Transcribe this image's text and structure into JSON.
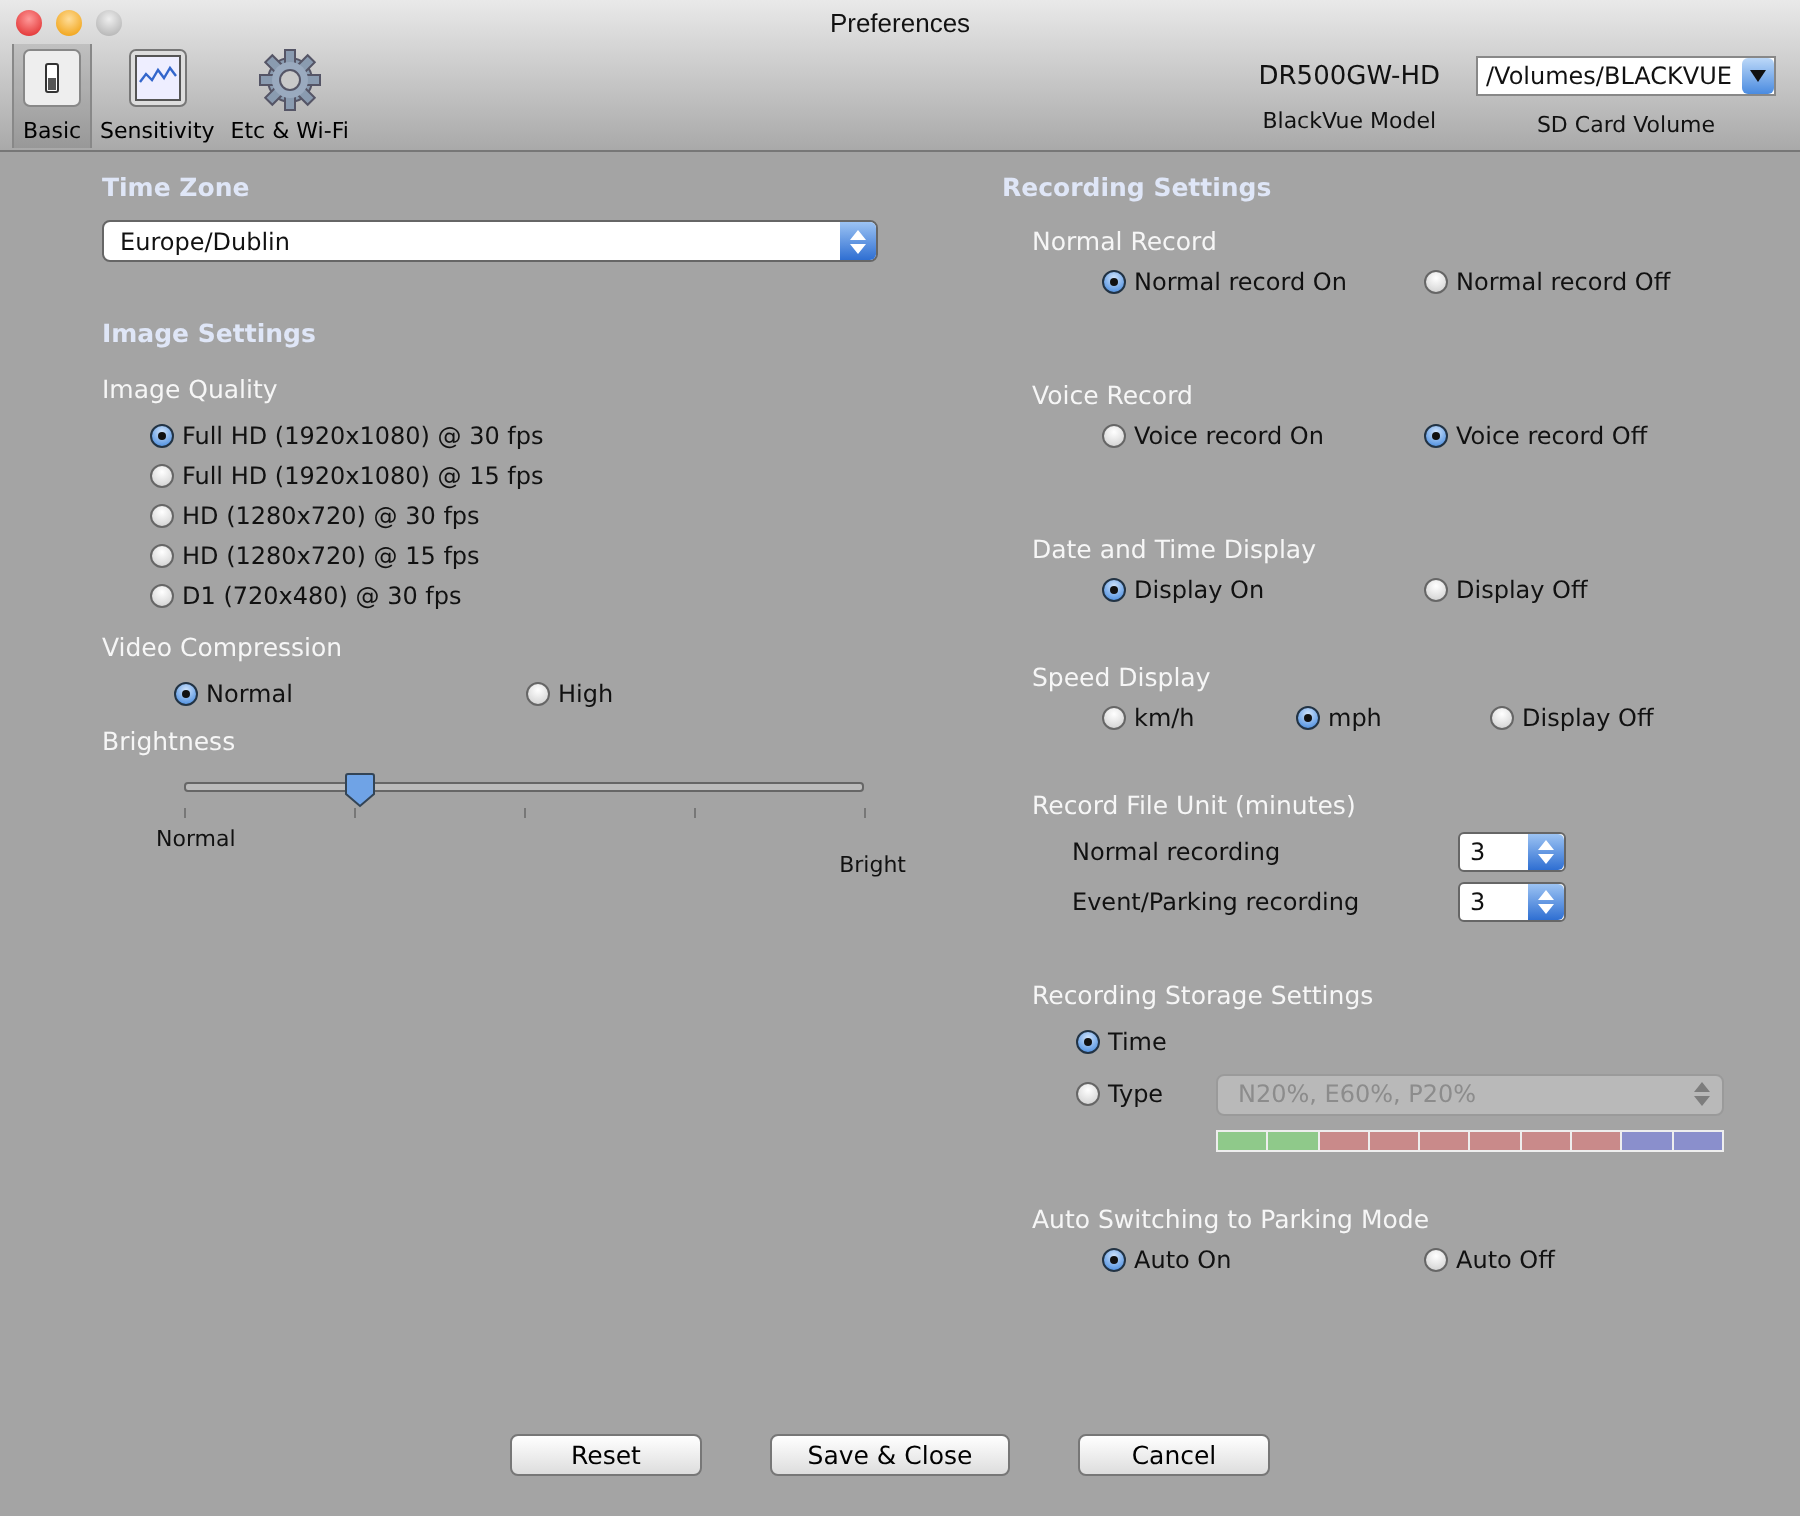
{
  "window": {
    "title": "Preferences"
  },
  "toolbar": [
    {
      "label": "Basic",
      "selected": true
    },
    {
      "label": "Sensitivity",
      "selected": false
    },
    {
      "label": "Etc & Wi-Fi",
      "selected": false
    }
  ],
  "device": {
    "model": "DR500GW-HD",
    "model_caption": "BlackVue Model",
    "volume": "/Volumes/BLACKVUE",
    "volume_caption": "SD Card Volume"
  },
  "time_zone": {
    "heading": "Time Zone",
    "value": "Europe/Dublin"
  },
  "image_settings": {
    "heading": "Image Settings",
    "quality": {
      "label": "Image Quality",
      "options": [
        {
          "label": "Full HD (1920x1080) @ 30 fps",
          "selected": true
        },
        {
          "label": "Full HD (1920x1080) @ 15 fps",
          "selected": false
        },
        {
          "label": "HD (1280x720) @ 30 fps",
          "selected": false
        },
        {
          "label": "HD (1280x720) @ 15 fps",
          "selected": false
        },
        {
          "label": "D1 (720x480) @ 30 fps",
          "selected": false
        }
      ]
    },
    "compression": {
      "label": "Video Compression",
      "options": [
        {
          "label": "Normal",
          "selected": true
        },
        {
          "label": "High",
          "selected": false
        }
      ]
    },
    "brightness": {
      "label": "Brightness",
      "level": 0.26,
      "min_label": "Normal",
      "max_label": "Bright"
    }
  },
  "recording_settings": {
    "heading": "Recording Settings",
    "radio_groups": [
      {
        "label": "Normal Record",
        "options": [
          {
            "label": "Normal record On",
            "selected": true
          },
          {
            "label": "Normal record Off",
            "selected": false
          }
        ]
      },
      {
        "label": "Voice Record",
        "options": [
          {
            "label": "Voice record On",
            "selected": false
          },
          {
            "label": "Voice record Off",
            "selected": true
          }
        ]
      },
      {
        "label": "Date and Time Display",
        "options": [
          {
            "label": "Display On",
            "selected": true
          },
          {
            "label": "Display Off",
            "selected": false
          }
        ]
      },
      {
        "label": "Speed Display",
        "options": [
          {
            "label": "km/h",
            "selected": false
          },
          {
            "label": "mph",
            "selected": true
          },
          {
            "label": "Display Off",
            "selected": false
          }
        ]
      }
    ],
    "file_unit": {
      "label": "Record File Unit (minutes)",
      "rows": [
        {
          "label": "Normal recording",
          "value": "3"
        },
        {
          "label": "Event/Parking recording",
          "value": "3"
        }
      ]
    },
    "storage": {
      "label": "Recording Storage Settings",
      "options": [
        {
          "label": "Time",
          "selected": true
        },
        {
          "label": "Type",
          "selected": false
        }
      ],
      "type_value": "N20%, E60%, P20%",
      "disabled": true,
      "segments": [
        {
          "color": "#8fc98a"
        },
        {
          "color": "#8fc98a"
        },
        {
          "color": "#c98a8a"
        },
        {
          "color": "#c98a8a"
        },
        {
          "color": "#c98a8a"
        },
        {
          "color": "#c98a8a"
        },
        {
          "color": "#c98a8a"
        },
        {
          "color": "#c98a8a"
        },
        {
          "color": "#8a8fcc"
        },
        {
          "color": "#8a8fcc"
        }
      ]
    },
    "parking": {
      "label": "Auto Switching to Parking Mode",
      "options": [
        {
          "label": "Auto On",
          "selected": true
        },
        {
          "label": "Auto Off",
          "selected": false
        }
      ]
    }
  },
  "buttons": [
    "Reset",
    "Save & Close",
    "Cancel"
  ]
}
